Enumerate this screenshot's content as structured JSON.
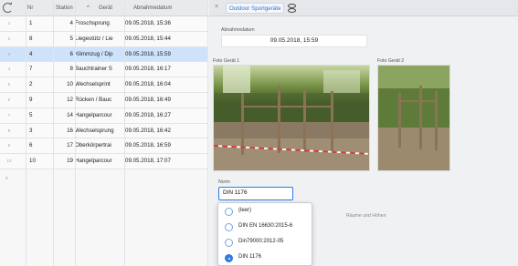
{
  "table": {
    "headers": {
      "nr": "Nr",
      "station": "Station",
      "sort": "^",
      "geraet": "Gerät",
      "datum": "Abnahmedatum"
    },
    "rows": [
      {
        "idx": "1",
        "nr": "1",
        "station": "4",
        "geraet": "Froschsprung",
        "datum": "09.05.2018, 15:36"
      },
      {
        "idx": "2",
        "nr": "8",
        "station": "5",
        "geraet": "Liegestütz / Lie",
        "datum": "09.05.2018, 15:44"
      },
      {
        "idx": "3",
        "nr": "4",
        "station": "6",
        "geraet": "Klimmzug / Dip",
        "datum": "09.05.2018, 15:59"
      },
      {
        "idx": "4",
        "nr": "7",
        "station": "8",
        "geraet": "Bauchtrainer S",
        "datum": "09.05.2018, 16:17"
      },
      {
        "idx": "5",
        "nr": "2",
        "station": "10",
        "geraet": "Wechselsprint",
        "datum": "09.05.2018, 16:04"
      },
      {
        "idx": "6",
        "nr": "9",
        "station": "12",
        "geraet": "Rücken / Bauc",
        "datum": "09.05.2018, 16:49"
      },
      {
        "idx": "7",
        "nr": "5",
        "station": "14",
        "geraet": "Hangelparcour",
        "datum": "09.05.2018, 16:27"
      },
      {
        "idx": "8",
        "nr": "3",
        "station": "16",
        "geraet": "Wechselsprung",
        "datum": "09.05.2018, 16:42"
      },
      {
        "idx": "9",
        "nr": "6",
        "station": "17",
        "geraet": "Oberkörpertrai",
        "datum": "09.05.2018, 16:59"
      },
      {
        "idx": "10",
        "nr": "10",
        "station": "19",
        "geraet": "Hangelparcour",
        "datum": "09.05.2018, 17:07"
      }
    ],
    "selected_row": 2,
    "add_row_marker": "*"
  },
  "detail": {
    "tab_title": "Outdoor Sportgeräte",
    "abnahme_label": "Abnahmedatum",
    "abnahme_value": "09.05.2018, 15:59",
    "foto1_label": "Foto Gerät 1",
    "foto2_label": "Foto Gerät 2",
    "norm_label": "Norm",
    "norm_value": "DIN 1176",
    "hint_text": "Räume und Höhen",
    "options": [
      {
        "label": "(leer)",
        "selected": false
      },
      {
        "label": "DIN EN 16630:2015-6",
        "selected": false
      },
      {
        "label": "Din79000:2012-05",
        "selected": false
      },
      {
        "label": "DIN 1176",
        "selected": true
      }
    ]
  },
  "colors": {
    "accent": "#2f7ae5",
    "selection": "#cfe2fb"
  }
}
